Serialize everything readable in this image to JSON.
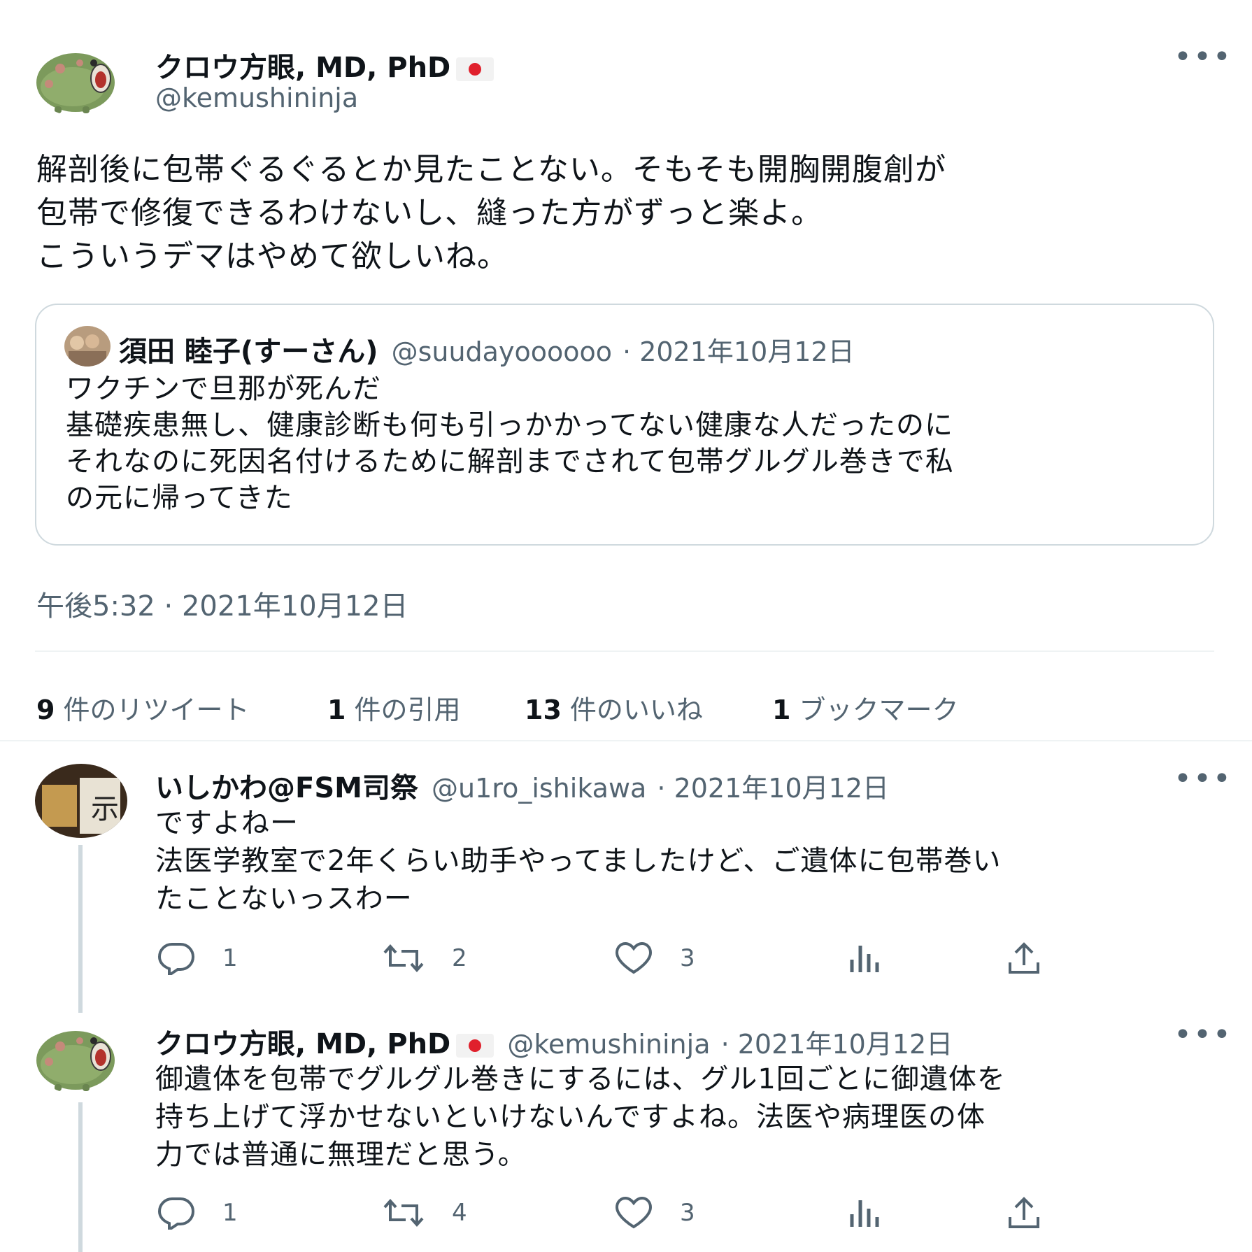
{
  "main_tweet": {
    "author_name": "クロウ方眼, MD, PhD",
    "author_handle": "@kemushininja",
    "text": "解剖後に包帯ぐるぐるとか見たことない。そもそも開胸開腹創が\n包帯で修復できるわけないし、縫った方がずっと楽よ。\nこういうデマはやめて欲しいね。",
    "timestamp": "午後5:32 · 2021年10月12日"
  },
  "quoted_tweet": {
    "author_name": "須田 睦子(すーさん)",
    "author_handle": "@suudayoooooo",
    "date": "· 2021年10月12日",
    "text": "ワクチンで旦那が死んだ\n基礎疾患無し、健康診断も何も引っかかってない健康な人だったのに\nそれなのに死因名付けるために解剖までされて包帯グルグル巻きで私\nの元に帰ってきた"
  },
  "stats": [
    {
      "count": "9",
      "label": "件のリツイート"
    },
    {
      "count": "1",
      "label": "件の引用"
    },
    {
      "count": "13",
      "label": "件のいいね"
    },
    {
      "count": "1",
      "label": "ブックマーク"
    }
  ],
  "replies": [
    {
      "author_name": "いしかわ@FSM司祭",
      "author_handle": "@u1ro_ishikawa",
      "date": "· 2021年10月12日",
      "text": "ですよねー\n法医学教室で2年くらい助手やってましたけど、ご遺体に包帯巻い\nたことないっスわー",
      "reply_count": "1",
      "retweet_count": "2",
      "like_count": "3"
    },
    {
      "author_name": "クロウ方眼, MD, PhD",
      "author_handle": "@kemushininja",
      "date": "· 2021年10月12日",
      "text": "御遺体を包帯でグルグル巻きにするには、グル1回ごとに御遺体を\n持ち上げて浮かせないといけないんですよね。法医や病理医の体\n力では普通に無理だと思う。",
      "reply_count": "1",
      "retweet_count": "4",
      "like_count": "3"
    }
  ],
  "icons": {
    "more": "more-options-icon",
    "reply": "reply-icon",
    "retweet": "retweet-icon",
    "like": "heart-icon",
    "views": "analytics-icon",
    "share": "share-icon"
  },
  "colors": {
    "text": "#0f1419",
    "secondary": "#536471",
    "border": "#cfd9de",
    "flag_red": "#e0202c",
    "avatar_green": "#7c9a5c"
  }
}
